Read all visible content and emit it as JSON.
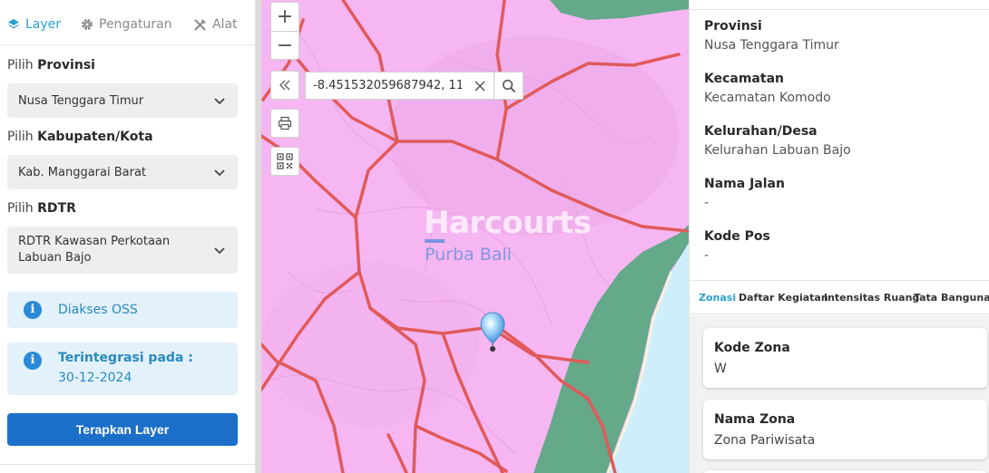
{
  "sidebar": {
    "tabs": [
      {
        "label": "Layer",
        "icon": "layers-icon",
        "active": true
      },
      {
        "label": "Pengaturan",
        "icon": "gear-icon",
        "active": false
      },
      {
        "label": "Alat",
        "icon": "tools-icon",
        "active": false
      }
    ],
    "provinsi": {
      "prefix": "Pilih ",
      "label": "Provinsi",
      "value": "Nusa Tenggara Timur"
    },
    "kabupaten": {
      "prefix": "Pilih ",
      "label": "Kabupaten/Kota",
      "value": "Kab. Manggarai Barat"
    },
    "rdtr": {
      "prefix": "Pilih ",
      "label": "RDTR",
      "value": "RDTR Kawasan Perkotaan Labuan Bajo"
    },
    "info_oss": {
      "text": "Diakses OSS"
    },
    "info_integrasi": {
      "title": "Terintegrasi pada :",
      "date": "30-12-2024"
    },
    "apply_button": "Terapkan Layer"
  },
  "map": {
    "zoom_in": "+",
    "zoom_out": "−",
    "coordinate": "-8.451532059687942, 11",
    "watermark_title": "Harcourts",
    "watermark_sub": "Purba Bali",
    "colors": {
      "zone_pink": "#f6b6f2",
      "road_red": "#e06060",
      "green_zone": "#63a98a",
      "water": "#cfeefc"
    }
  },
  "info_panel": {
    "fields": [
      {
        "key": "Provinsi",
        "value": "Nusa Tenggara Timur"
      },
      {
        "key": "Kecamatan",
        "value": "Kecamatan Komodo"
      },
      {
        "key": "Kelurahan/Desa",
        "value": "Kelurahan Labuan Bajo"
      },
      {
        "key": "Nama Jalan",
        "value": "-"
      },
      {
        "key": "Kode Pos",
        "value": "-"
      }
    ],
    "tabs": [
      {
        "label": "Zonasi",
        "active": true
      },
      {
        "label": "Daftar Kegiatan",
        "active": false
      },
      {
        "label": "Intensitas Ruang",
        "active": false
      },
      {
        "label": "Tata Bangunan",
        "active": false
      }
    ],
    "cards": [
      {
        "key": "Kode Zona",
        "value": "W"
      },
      {
        "key": "Nama Zona",
        "value": "Zona Pariwisata"
      }
    ]
  }
}
